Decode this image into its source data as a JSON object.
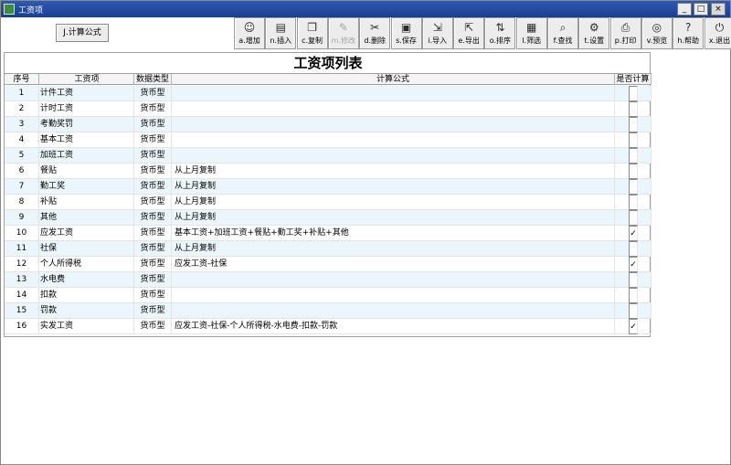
{
  "window": {
    "title": "工资项"
  },
  "window_buttons": [
    "_",
    "□",
    "×"
  ],
  "calc_button": "J.计算公式",
  "toolbar": [
    {
      "label": "a.增加",
      "icon": "☺",
      "name": "add-button",
      "disabled": false
    },
    {
      "label": "n.插入",
      "icon": "▤",
      "name": "insert-button",
      "disabled": false
    },
    {
      "label": "c.复制",
      "icon": "❐",
      "name": "copy-button",
      "disabled": false
    },
    {
      "label": "m.修改",
      "icon": "✎",
      "name": "modify-button",
      "disabled": true
    },
    {
      "label": "d.删除",
      "icon": "✂",
      "name": "delete-button",
      "disabled": false
    },
    {
      "label": "s.保存",
      "icon": "▣",
      "name": "save-button",
      "disabled": false
    },
    {
      "label": "i.导入",
      "icon": "⇲",
      "name": "import-button",
      "disabled": false
    },
    {
      "label": "e.导出",
      "icon": "⇱",
      "name": "export-button",
      "disabled": false
    },
    {
      "label": "o.排序",
      "icon": "⇅",
      "name": "sort-button",
      "disabled": false
    },
    {
      "label": "l.筛选",
      "icon": "▦",
      "name": "filter-button",
      "disabled": false
    },
    {
      "label": "f.查找",
      "icon": "⌕",
      "name": "find-button",
      "disabled": false
    },
    {
      "label": "t.设置",
      "icon": "⚙",
      "name": "settings-button",
      "disabled": false
    },
    {
      "label": "p.打印",
      "icon": "⎙",
      "name": "print-button",
      "disabled": false
    },
    {
      "label": "v.预览",
      "icon": "◎",
      "name": "preview-button",
      "disabled": false
    },
    {
      "label": "h.帮助",
      "icon": "?",
      "name": "help-button",
      "disabled": false
    },
    {
      "label": "x.退出",
      "icon": "⏻",
      "name": "exit-button",
      "disabled": false
    }
  ],
  "table": {
    "title": "工资项列表",
    "headers": {
      "no": "序号",
      "name": "工资项",
      "type": "数据类型",
      "formula": "计算公式",
      "calc": "是否计算"
    },
    "rows": [
      {
        "no": "1",
        "name": "计件工资",
        "type": "货币型",
        "formula": "",
        "checked": false
      },
      {
        "no": "2",
        "name": "计时工资",
        "type": "货币型",
        "formula": "",
        "checked": false
      },
      {
        "no": "3",
        "name": "考勤奖罚",
        "type": "货币型",
        "formula": "",
        "checked": false
      },
      {
        "no": "4",
        "name": "基本工资",
        "type": "货币型",
        "formula": "",
        "checked": false
      },
      {
        "no": "5",
        "name": "加班工资",
        "type": "货币型",
        "formula": "",
        "checked": false
      },
      {
        "no": "6",
        "name": "餐贴",
        "type": "货币型",
        "formula": "从上月复制",
        "checked": false
      },
      {
        "no": "7",
        "name": "勤工奖",
        "type": "货币型",
        "formula": "从上月复制",
        "checked": false
      },
      {
        "no": "8",
        "name": "补贴",
        "type": "货币型",
        "formula": "从上月复制",
        "checked": false
      },
      {
        "no": "9",
        "name": "其他",
        "type": "货币型",
        "formula": "从上月复制",
        "checked": false
      },
      {
        "no": "10",
        "name": "应发工资",
        "type": "货币型",
        "formula": "基本工资+加班工资+餐贴+勤工奖+补贴+其他",
        "checked": true
      },
      {
        "no": "11",
        "name": "社保",
        "type": "货币型",
        "formula": "从上月复制",
        "checked": false
      },
      {
        "no": "12",
        "name": "个人所得税",
        "type": "货币型",
        "formula": "应发工资-社保",
        "checked": true
      },
      {
        "no": "13",
        "name": "水电费",
        "type": "货币型",
        "formula": "",
        "checked": false
      },
      {
        "no": "14",
        "name": "扣款",
        "type": "货币型",
        "formula": "",
        "checked": false
      },
      {
        "no": "15",
        "name": "罚款",
        "type": "货币型",
        "formula": "",
        "checked": false
      },
      {
        "no": "16",
        "name": "实发工资",
        "type": "货币型",
        "formula": "应发工资-社保-个人所得税-水电费-扣款-罚款",
        "checked": true
      }
    ]
  }
}
